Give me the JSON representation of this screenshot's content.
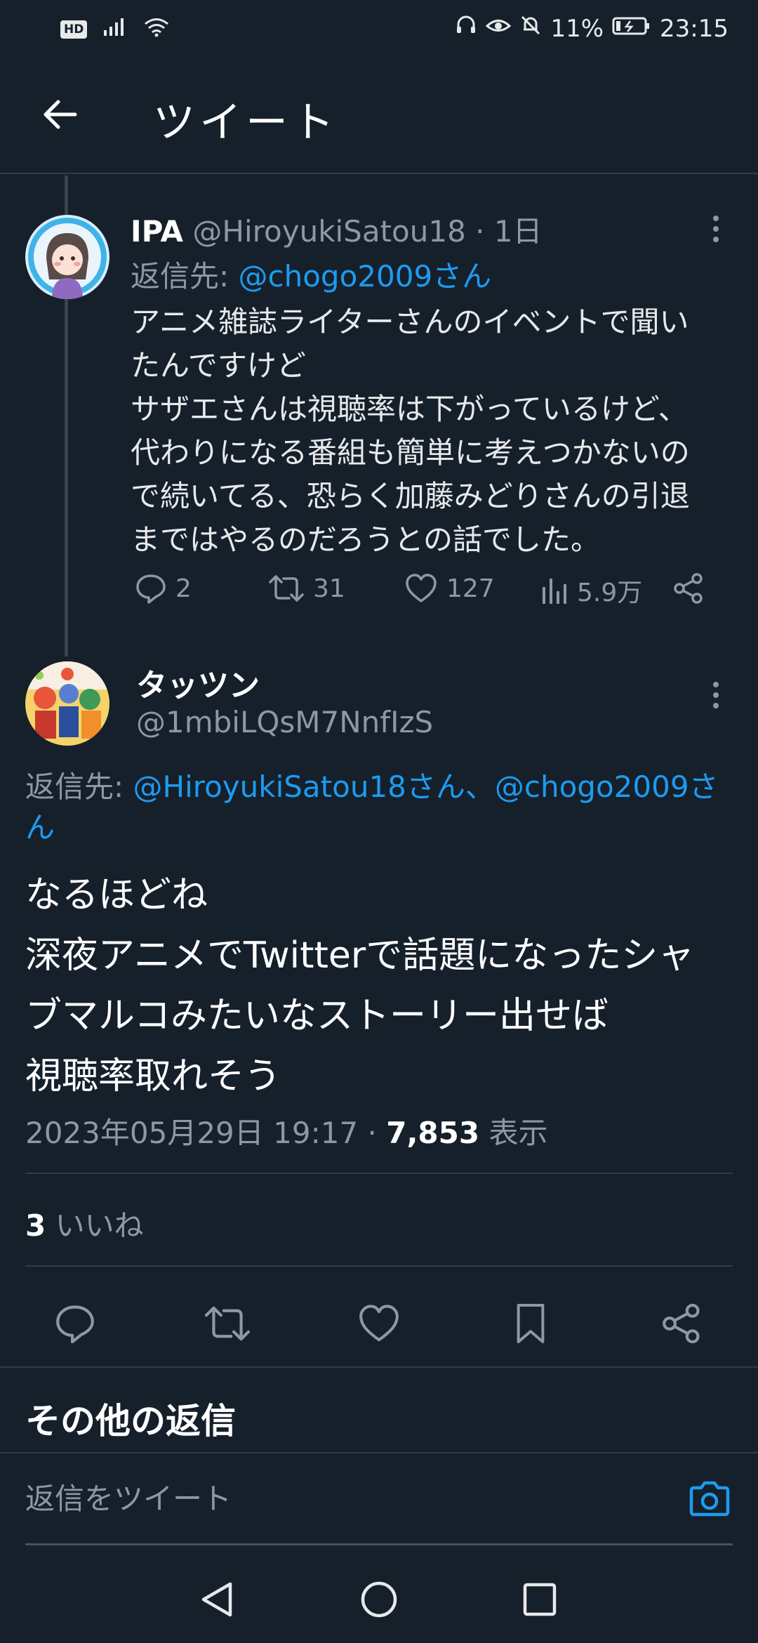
{
  "status_bar": {
    "hd": "HD",
    "battery": "11%",
    "time": "23:15"
  },
  "header": {
    "title": "ツイート"
  },
  "parent_tweet": {
    "name": "IPA",
    "handle": "@HiroyukiSatou18",
    "separator": "·",
    "age": "1日",
    "reply_prefix": "返信先:",
    "reply_to": "@chogo2009さん",
    "text": "アニメ雑誌ライターさんのイベントで聞い\nたんですけど\nサザエさんは視聴率は下がっているけど、\n代わりになる番組も簡単に考えつかないの\nで続いてる、恐らく加藤みどりさんの引退\nまではやるのだろうとの話でした。",
    "replies": "2",
    "retweets": "31",
    "likes": "127",
    "views": "5.9万"
  },
  "main_tweet": {
    "name": "タッツン",
    "handle": "@1mbiLQsM7NnfIzS",
    "reply_prefix": "返信先:",
    "reply_to": "@HiroyukiSatou18さん、@chogo2009さん",
    "text": "なるほどね\n深夜アニメでTwitterで話題になったシャ\nブマルコみたいなストーリー出せば\n視聴率取れそう",
    "datetime": "2023年05月29日 19:17",
    "separator": "·",
    "views_count": "7,853",
    "views_label": "表示",
    "likes_count": "3",
    "likes_label": "いいね"
  },
  "section": {
    "more_replies": "その他の返信"
  },
  "compose": {
    "placeholder": "返信をツイート"
  },
  "colors": {
    "background": "#15202b",
    "accent": "#1d9bf0",
    "muted": "#8b98a5",
    "divider": "#2f3b48"
  }
}
